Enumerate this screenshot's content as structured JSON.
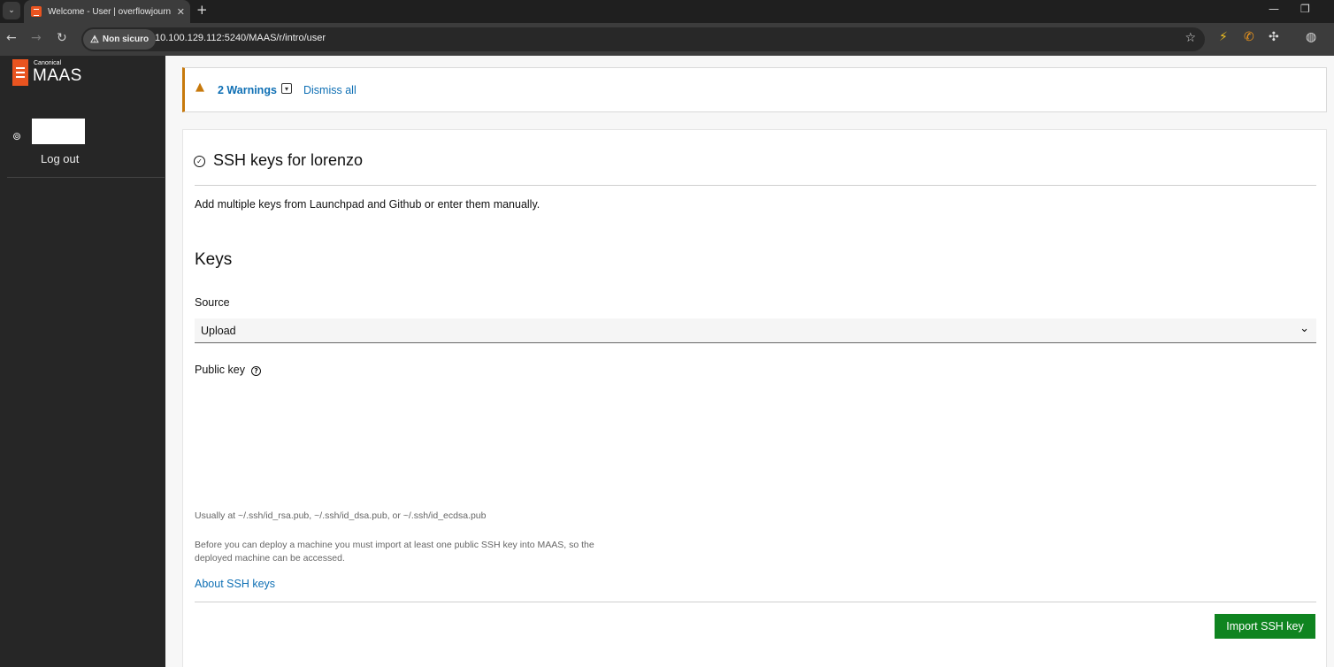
{
  "browser": {
    "tab_title": "Welcome - User | overflowjourn",
    "security_label": "Non sicuro",
    "url": "10.100.129.112:5240/MAAS/r/intro/user"
  },
  "sidebar": {
    "brand_small": "Canonical",
    "brand": "MAAS",
    "logout_label": "Log out"
  },
  "notification": {
    "warnings_label": "2 Warnings",
    "dismiss_label": "Dismiss all"
  },
  "card": {
    "title": "SSH keys for lorenzo",
    "description": "Add multiple keys from Launchpad and Github or enter them manually.",
    "keys_heading": "Keys",
    "source_label": "Source",
    "source_value": "Upload",
    "public_key_label": "Public key",
    "hint_path": "Usually at ~/.ssh/id_rsa.pub, ~/.ssh/id_dsa.pub, or ~/.ssh/id_ecdsa.pub",
    "hint_deploy": "Before you can deploy a machine you must import at least one public SSH key into MAAS, so the deployed machine can be accessed.",
    "about_link": "About SSH keys",
    "import_button": "Import SSH key"
  },
  "colors": {
    "brand_orange": "#e95420",
    "warning": "#c7790c",
    "link": "#0e6fb4",
    "positive_button": "#0f8420"
  }
}
